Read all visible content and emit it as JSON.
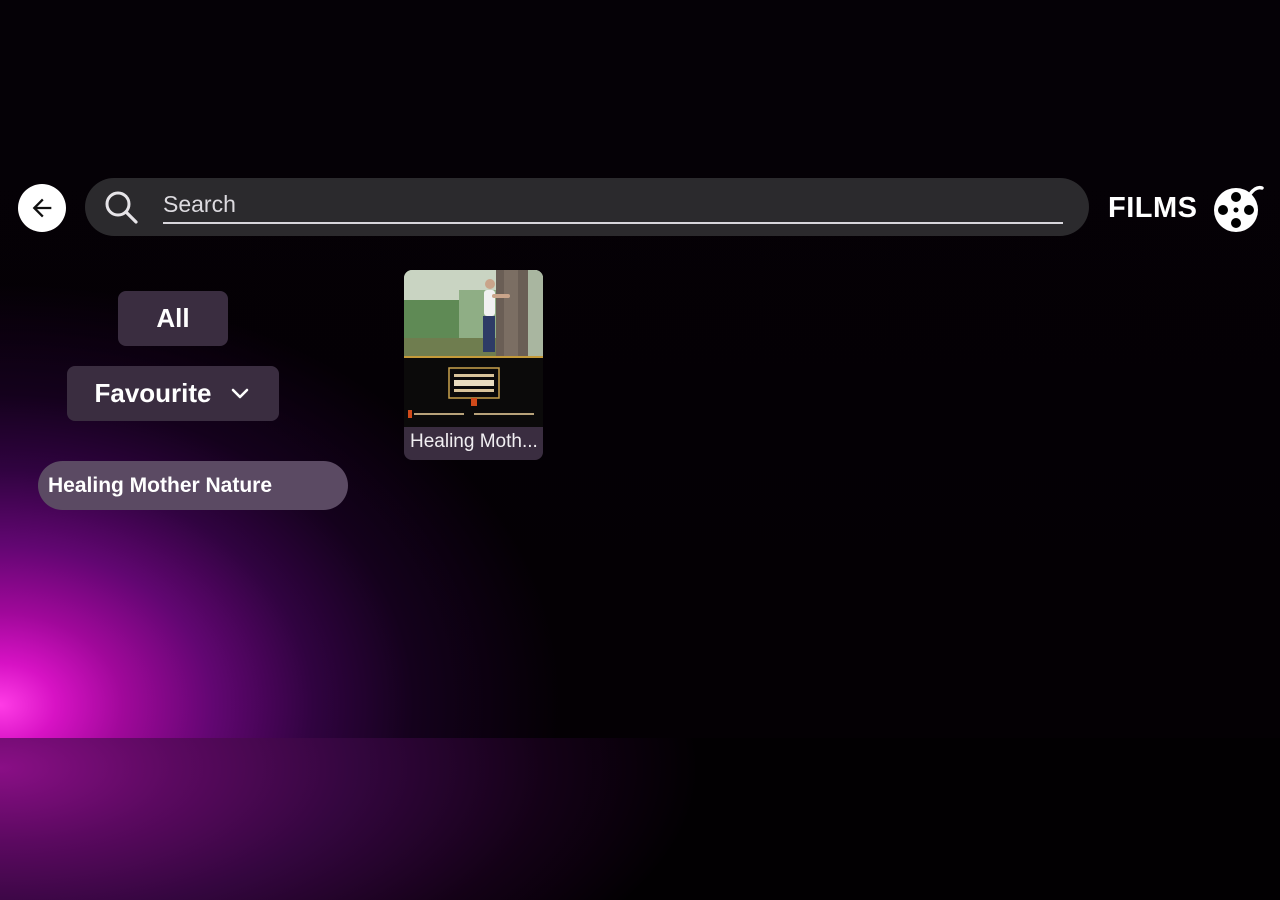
{
  "header": {
    "search_placeholder": "Search",
    "section_title": "FILMS"
  },
  "filters": {
    "all_label": "All",
    "favourite_label": "Favourite",
    "playlist_label": "Healing Mother Nature"
  },
  "films": [
    {
      "title": "Healing Moth..."
    }
  ],
  "icons": {
    "back": "arrow-left-icon",
    "search": "search-icon",
    "section": "film-reel-icon",
    "dropdown": "chevron-down-icon"
  },
  "colors": {
    "accent_glow": "#ff3ce6",
    "chip": "#3a2d40",
    "search_bar": "#2b2a2d"
  }
}
